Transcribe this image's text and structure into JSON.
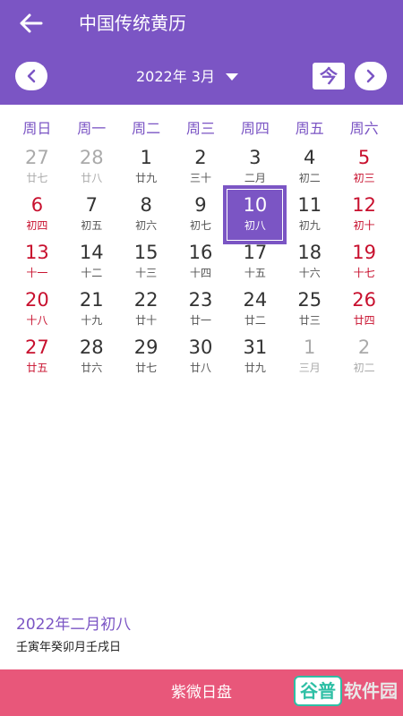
{
  "header": {
    "title": "中国传统黄历",
    "month_label": "2022年 3月",
    "today_label": "今"
  },
  "weekdays": [
    "周日",
    "周一",
    "周二",
    "周三",
    "周四",
    "周五",
    "周六"
  ],
  "days": [
    {
      "num": "27",
      "lunar": "廿七",
      "type": "other"
    },
    {
      "num": "28",
      "lunar": "廿八",
      "type": "other"
    },
    {
      "num": "1",
      "lunar": "廿九",
      "type": "normal"
    },
    {
      "num": "2",
      "lunar": "三十",
      "type": "normal"
    },
    {
      "num": "3",
      "lunar": "二月",
      "type": "normal"
    },
    {
      "num": "4",
      "lunar": "初二",
      "type": "normal"
    },
    {
      "num": "5",
      "lunar": "初三",
      "type": "weekend"
    },
    {
      "num": "6",
      "lunar": "初四",
      "type": "weekend"
    },
    {
      "num": "7",
      "lunar": "初五",
      "type": "normal"
    },
    {
      "num": "8",
      "lunar": "初六",
      "type": "normal"
    },
    {
      "num": "9",
      "lunar": "初七",
      "type": "normal"
    },
    {
      "num": "10",
      "lunar": "初八",
      "type": "selected"
    },
    {
      "num": "11",
      "lunar": "初九",
      "type": "normal"
    },
    {
      "num": "12",
      "lunar": "初十",
      "type": "weekend"
    },
    {
      "num": "13",
      "lunar": "十一",
      "type": "weekend"
    },
    {
      "num": "14",
      "lunar": "十二",
      "type": "normal"
    },
    {
      "num": "15",
      "lunar": "十三",
      "type": "normal"
    },
    {
      "num": "16",
      "lunar": "十四",
      "type": "normal"
    },
    {
      "num": "17",
      "lunar": "十五",
      "type": "normal"
    },
    {
      "num": "18",
      "lunar": "十六",
      "type": "normal"
    },
    {
      "num": "19",
      "lunar": "十七",
      "type": "weekend"
    },
    {
      "num": "20",
      "lunar": "十八",
      "type": "weekend"
    },
    {
      "num": "21",
      "lunar": "十九",
      "type": "normal"
    },
    {
      "num": "22",
      "lunar": "廿十",
      "type": "normal"
    },
    {
      "num": "23",
      "lunar": "廿一",
      "type": "normal"
    },
    {
      "num": "24",
      "lunar": "廿二",
      "type": "normal"
    },
    {
      "num": "25",
      "lunar": "廿三",
      "type": "normal"
    },
    {
      "num": "26",
      "lunar": "廿四",
      "type": "weekend"
    },
    {
      "num": "27",
      "lunar": "廿五",
      "type": "weekend"
    },
    {
      "num": "28",
      "lunar": "廿六",
      "type": "normal"
    },
    {
      "num": "29",
      "lunar": "廿七",
      "type": "normal"
    },
    {
      "num": "30",
      "lunar": "廿八",
      "type": "normal"
    },
    {
      "num": "31",
      "lunar": "廿九",
      "type": "normal"
    },
    {
      "num": "1",
      "lunar": "三月",
      "type": "other"
    },
    {
      "num": "2",
      "lunar": "初二",
      "type": "other"
    }
  ],
  "info": {
    "lunar_date": "2022年二月初八",
    "ganzhi": "壬寅年癸卯月壬戌日"
  },
  "bottom_button": {
    "label": "紫微日盘"
  },
  "watermark": {
    "box_text": "谷普",
    "text": "软件园"
  },
  "colors": {
    "primary": "#7b55c4",
    "weekend": "#c8102e",
    "other_month": "#aaaaaa",
    "bottom_button": "#e8577a",
    "watermark": "#2ebfa5"
  }
}
